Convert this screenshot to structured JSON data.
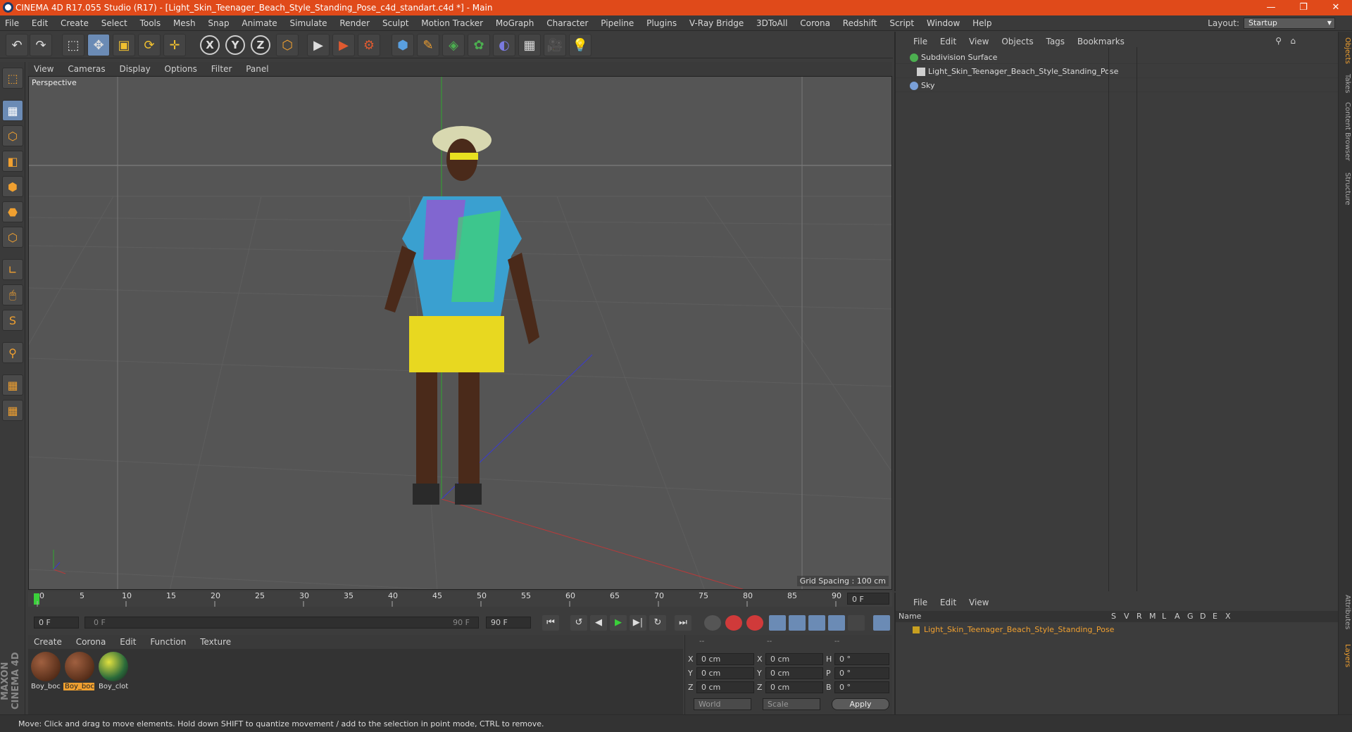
{
  "window": {
    "title": "CINEMA 4D R17.055 Studio (R17) - [Light_Skin_Teenager_Beach_Style_Standing_Pose_c4d_standart.c4d *] - Main",
    "minimize": "—",
    "restore": "❐",
    "close": "✕"
  },
  "menubar": {
    "items": [
      "File",
      "Edit",
      "Create",
      "Select",
      "Tools",
      "Mesh",
      "Snap",
      "Animate",
      "Simulate",
      "Render",
      "Sculpt",
      "Motion Tracker",
      "MoGraph",
      "Character",
      "Pipeline",
      "Plugins",
      "V-Ray Bridge",
      "3DToAll",
      "Corona",
      "Redshift",
      "Script",
      "Window",
      "Help"
    ],
    "layout_label": "Layout:",
    "layout_value": "Startup"
  },
  "toolbar": {
    "undo": "↶",
    "redo": "↷",
    "select": "⬚",
    "move": "✥",
    "scale": "▣",
    "rotate": "⟳",
    "transform": "✛",
    "x": "X",
    "y": "Y",
    "z": "Z",
    "coord": "⬡",
    "render_view": "▶",
    "render_pic": "▶",
    "render_settings": "⚙",
    "cube": "⬢",
    "pen": "✎",
    "subdiv": "◈",
    "array": "✿",
    "deform": "◐",
    "floor": "▦",
    "camera": "🎥",
    "light": "💡"
  },
  "left_tools": [
    "⬚",
    "▦",
    "⬡",
    "◧",
    "⬢",
    "⬣",
    "⬡",
    "∟",
    "🖱",
    "S",
    "⚲",
    "▦",
    "▦"
  ],
  "viewport": {
    "menu": [
      "View",
      "Cameras",
      "Display",
      "Options",
      "Filter",
      "Panel"
    ],
    "label": "Perspective",
    "grid_spacing": "Grid Spacing : 100 cm"
  },
  "timeline": {
    "ticks": [
      "0",
      "5",
      "10",
      "15",
      "20",
      "25",
      "30",
      "35",
      "40",
      "45",
      "50",
      "55",
      "60",
      "65",
      "70",
      "75",
      "80",
      "85",
      "90"
    ],
    "current_frame": "0 F",
    "start_field": "0 F",
    "range_start": "0 F",
    "range_end": "90 F",
    "end_field": "90 F"
  },
  "transport": {
    "first": "⏮",
    "prev_key": "↺",
    "prev": "◀",
    "play": "▶",
    "next": "▶|",
    "next_key": "↻",
    "last": "⏭"
  },
  "materials": {
    "menu": [
      "Create",
      "Corona",
      "Edit",
      "Function",
      "Texture"
    ],
    "items": [
      {
        "name": "Boy_boc",
        "selected": false
      },
      {
        "name": "Boy_boc",
        "selected": true
      },
      {
        "name": "Boy_clot",
        "selected": false
      }
    ]
  },
  "coords": {
    "header": [
      "--",
      "--",
      "--"
    ],
    "rows": [
      {
        "axis": "X",
        "pos": "0 cm",
        "axis2": "X",
        "size": "0 cm",
        "rot_label": "H",
        "rot": "0 °"
      },
      {
        "axis": "Y",
        "pos": "0 cm",
        "axis2": "Y",
        "size": "0 cm",
        "rot_label": "P",
        "rot": "0 °"
      },
      {
        "axis": "Z",
        "pos": "0 cm",
        "axis2": "Z",
        "size": "0 cm",
        "rot_label": "B",
        "rot": "0 °"
      }
    ],
    "mode1": "World",
    "mode2": "Scale",
    "apply": "Apply"
  },
  "objects": {
    "menu": [
      "File",
      "Edit",
      "View",
      "Objects",
      "Tags",
      "Bookmarks"
    ],
    "items": [
      {
        "name": "Subdivision Surface",
        "color": "#4caf50"
      },
      {
        "name": "Light_Skin_Teenager_Beach_Style_Standing_Pose",
        "color": "#cfcfcf"
      },
      {
        "name": "Sky",
        "color": "#7aa0d8"
      }
    ]
  },
  "layers": {
    "menu": [
      "File",
      "Edit",
      "View"
    ],
    "col_name": "Name",
    "cols": [
      "S",
      "V",
      "R",
      "M",
      "L",
      "A",
      "G",
      "D",
      "E",
      "X"
    ],
    "row_name": "Light_Skin_Teenager_Beach_Style_Standing_Pose"
  },
  "right_tabs": [
    "Objects",
    "Takes",
    "Content Browser",
    "Structure",
    "Attributes",
    "Layers"
  ],
  "maxon": "MAXON CINEMA 4D",
  "status": "Move: Click and drag to move elements. Hold down SHIFT to quantize movement / add to the selection in point mode, CTRL to remove."
}
